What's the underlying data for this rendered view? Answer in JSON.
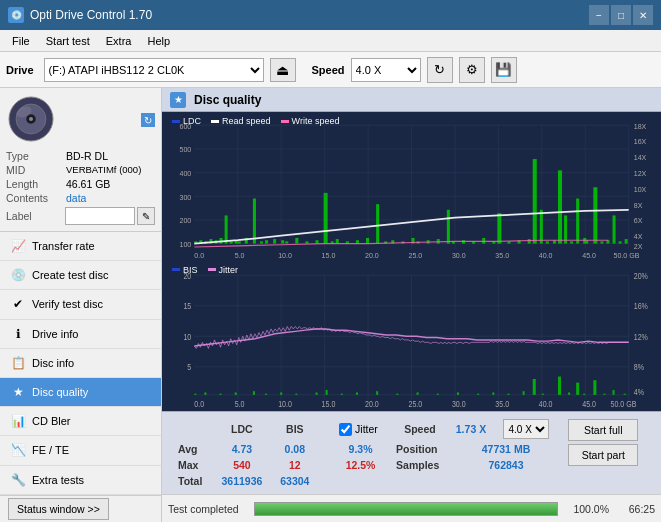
{
  "titlebar": {
    "title": "Opti Drive Control 1.70",
    "icon": "💿",
    "minimize": "−",
    "maximize": "□",
    "close": "✕"
  },
  "menubar": {
    "items": [
      "File",
      "Start test",
      "Extra",
      "Help"
    ]
  },
  "drivetoolbar": {
    "drive_label": "Drive",
    "drive_value": "(F:)  ATAPI iHBS112  2 CL0K",
    "eject_icon": "⏏",
    "speed_label": "Speed",
    "speed_value": "4.0 X"
  },
  "disc": {
    "type_label": "Type",
    "type_value": "BD-R DL",
    "mid_label": "MID",
    "mid_value": "VERBATIMf (000)",
    "length_label": "Length",
    "length_value": "46.61 GB",
    "contents_label": "Contents",
    "contents_value": "data",
    "label_label": "Label",
    "label_value": ""
  },
  "nav": {
    "items": [
      {
        "id": "transfer-rate",
        "label": "Transfer rate",
        "icon": "📈"
      },
      {
        "id": "create-test-disc",
        "label": "Create test disc",
        "icon": "💿"
      },
      {
        "id": "verify-test-disc",
        "label": "Verify test disc",
        "icon": "✔"
      },
      {
        "id": "drive-info",
        "label": "Drive info",
        "icon": "ℹ"
      },
      {
        "id": "disc-info",
        "label": "Disc info",
        "icon": "📋"
      },
      {
        "id": "disc-quality",
        "label": "Disc quality",
        "icon": "★",
        "active": true
      },
      {
        "id": "cd-bler",
        "label": "CD Bler",
        "icon": "📊"
      },
      {
        "id": "fe-te",
        "label": "FE / TE",
        "icon": "📉"
      },
      {
        "id": "extra-tests",
        "label": "Extra tests",
        "icon": "🔧"
      }
    ]
  },
  "status_window_btn": "Status window >>",
  "dq_title": "Disc quality",
  "legend_top": {
    "ldc": "LDC",
    "read_speed": "Read speed",
    "write_speed": "Write speed"
  },
  "legend_bottom": {
    "bis": "BIS",
    "jitter": "Jitter"
  },
  "chart_top": {
    "y_max": 600,
    "y_labels": [
      "600",
      "500",
      "400",
      "300",
      "200",
      "100"
    ],
    "y_right_labels": [
      "18X",
      "16X",
      "14X",
      "12X",
      "10X",
      "8X",
      "6X",
      "4X",
      "2X"
    ],
    "x_labels": [
      "0.0",
      "5.0",
      "10.0",
      "15.0",
      "20.0",
      "25.0",
      "30.0",
      "35.0",
      "40.0",
      "45.0",
      "50.0 GB"
    ]
  },
  "chart_bottom": {
    "y_max": 20,
    "y_labels": [
      "20",
      "15",
      "10",
      "5"
    ],
    "y_right_labels": [
      "20%",
      "16%",
      "12%",
      "8%",
      "4%"
    ],
    "x_labels": [
      "0.0",
      "5.0",
      "10.0",
      "15.0",
      "20.0",
      "25.0",
      "30.0",
      "35.0",
      "40.0",
      "45.0",
      "50.0 GB"
    ]
  },
  "stats": {
    "headers": [
      "",
      "LDC",
      "BIS",
      "",
      "Jitter",
      "Speed",
      "",
      ""
    ],
    "avg_label": "Avg",
    "avg_ldc": "4.73",
    "avg_bis": "0.08",
    "avg_jitter": "9.3%",
    "speed_val": "1.73 X",
    "speed_select": "4.0 X",
    "max_label": "Max",
    "max_ldc": "540",
    "max_bis": "12",
    "max_jitter": "12.5%",
    "position_label": "Position",
    "position_val": "47731 MB",
    "total_label": "Total",
    "total_ldc": "3611936",
    "total_bis": "63304",
    "samples_label": "Samples",
    "samples_val": "762843",
    "start_full_label": "Start full",
    "start_part_label": "Start part",
    "jitter_checked": true
  },
  "bottom": {
    "status_text": "Test completed",
    "progress_pct": 100,
    "progress_display": "100.0%",
    "progress_num": "66:25"
  },
  "colors": {
    "ldc_bar": "#00cc00",
    "read_speed": "#ffffff",
    "write_speed": "#ff69b4",
    "bis_bar": "#00cc00",
    "jitter_line": "#dd88dd",
    "accent_blue": "#1a6fc4",
    "chart_bg": "#1a2744",
    "grid_line": "#2a3a5a"
  }
}
